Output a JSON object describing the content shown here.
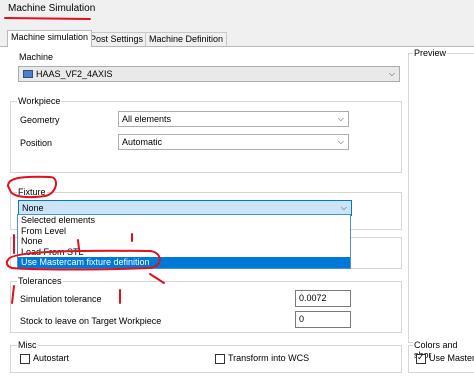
{
  "window": {
    "title": "Machine Simulation"
  },
  "tabs": [
    {
      "label": "Machine simulation"
    },
    {
      "label": "Post Settings"
    },
    {
      "label": "Machine Definition"
    }
  ],
  "machine": {
    "group_label": "Machine",
    "selected": "HAAS_VF2_4AXIS"
  },
  "workpiece": {
    "group_label": "Workpiece",
    "geometry_label": "Geometry",
    "geometry_value": "All elements",
    "position_label": "Position",
    "position_value": "Automatic"
  },
  "fixture": {
    "group_label": "Fixture",
    "selected": "None",
    "options": [
      "Selected elements",
      "From Level",
      "None",
      "Load From STL",
      "Use Mastercam fixture definition"
    ]
  },
  "preview": {
    "label": "Preview"
  },
  "tolerances": {
    "group_label": "Tolerances",
    "sim_label": "Simulation tolerance",
    "sim_value": "0.0072",
    "stock_label": "Stock to leave on Target Workpiece",
    "stock_value": "0"
  },
  "misc": {
    "group_label": "Misc",
    "autostart_label": "Autostart",
    "autostart_checked": false,
    "transform_label": "Transform into WCS",
    "transform_checked": false
  },
  "colors": {
    "group_label": "Colors and shor",
    "use_label": "Use Masterca",
    "use_checked": true
  },
  "annotation_color": "#e0101c"
}
